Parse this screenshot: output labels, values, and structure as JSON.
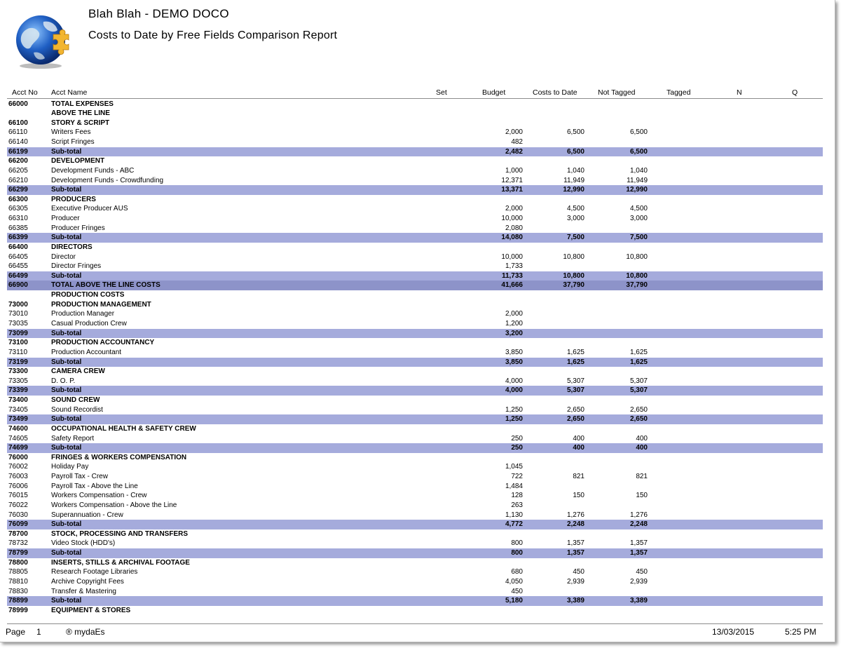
{
  "report": {
    "company": "Blah Blah - DEMO DOCO",
    "title": "Costs to Date by Free Fields Comparison Report"
  },
  "columns": {
    "acct_no": "Acct No",
    "acct_name": "Acct Name",
    "set": "Set",
    "budget": "Budget",
    "costs_to_date": "Costs to Date",
    "not_tagged": "Not Tagged",
    "tagged": "Tagged",
    "n": "N",
    "q": "Q"
  },
  "rows": [
    {
      "type": "head",
      "acct": "66000",
      "name": "TOTAL EXPENSES",
      "budget": "",
      "ctd": "",
      "nt": ""
    },
    {
      "type": "head",
      "acct": "",
      "name": "ABOVE THE LINE",
      "budget": "",
      "ctd": "",
      "nt": ""
    },
    {
      "type": "head",
      "acct": "66100",
      "name": "STORY & SCRIPT",
      "budget": "",
      "ctd": "",
      "nt": ""
    },
    {
      "type": "item",
      "acct": "66110",
      "name": "Writers Fees",
      "budget": "2,000",
      "ctd": "6,500",
      "nt": "6,500"
    },
    {
      "type": "item",
      "acct": "66140",
      "name": "Script Fringes",
      "budget": "482",
      "ctd": "",
      "nt": ""
    },
    {
      "type": "sub",
      "acct": "66199",
      "name": "Sub-total",
      "budget": "2,482",
      "ctd": "6,500",
      "nt": "6,500"
    },
    {
      "type": "head",
      "acct": "66200",
      "name": "DEVELOPMENT",
      "budget": "",
      "ctd": "",
      "nt": ""
    },
    {
      "type": "item",
      "acct": "66205",
      "name": "Development Funds - ABC",
      "budget": "1,000",
      "ctd": "1,040",
      "nt": "1,040"
    },
    {
      "type": "item",
      "acct": "66210",
      "name": "Development Funds - Crowdfunding",
      "budget": "12,371",
      "ctd": "11,949",
      "nt": "11,949"
    },
    {
      "type": "sub",
      "acct": "66299",
      "name": "Sub-total",
      "budget": "13,371",
      "ctd": "12,990",
      "nt": "12,990"
    },
    {
      "type": "head",
      "acct": "66300",
      "name": "PRODUCERS",
      "budget": "",
      "ctd": "",
      "nt": ""
    },
    {
      "type": "item",
      "acct": "66305",
      "name": "Executive Producer AUS",
      "budget": "2,000",
      "ctd": "4,500",
      "nt": "4,500"
    },
    {
      "type": "item",
      "acct": "66310",
      "name": "Producer",
      "budget": "10,000",
      "ctd": "3,000",
      "nt": "3,000"
    },
    {
      "type": "item",
      "acct": "66385",
      "name": "Producer Fringes",
      "budget": "2,080",
      "ctd": "",
      "nt": ""
    },
    {
      "type": "sub",
      "acct": "66399",
      "name": "Sub-total",
      "budget": "14,080",
      "ctd": "7,500",
      "nt": "7,500"
    },
    {
      "type": "head",
      "acct": "66400",
      "name": "DIRECTORS",
      "budget": "",
      "ctd": "",
      "nt": ""
    },
    {
      "type": "item",
      "acct": "66405",
      "name": "Director",
      "budget": "10,000",
      "ctd": "10,800",
      "nt": "10,800"
    },
    {
      "type": "item",
      "acct": "66455",
      "name": "Director Fringes",
      "budget": "1,733",
      "ctd": "",
      "nt": ""
    },
    {
      "type": "sub",
      "acct": "66499",
      "name": "Sub-total",
      "budget": "11,733",
      "ctd": "10,800",
      "nt": "10,800"
    },
    {
      "type": "tot",
      "acct": "66900",
      "name": "TOTAL ABOVE THE LINE COSTS",
      "budget": "41,666",
      "ctd": "37,790",
      "nt": "37,790"
    },
    {
      "type": "head",
      "acct": "",
      "name": "PRODUCTION COSTS",
      "budget": "",
      "ctd": "",
      "nt": ""
    },
    {
      "type": "head",
      "acct": "73000",
      "name": "PRODUCTION MANAGEMENT",
      "budget": "",
      "ctd": "",
      "nt": ""
    },
    {
      "type": "item",
      "acct": "73010",
      "name": "Production Manager",
      "budget": "2,000",
      "ctd": "",
      "nt": ""
    },
    {
      "type": "item",
      "acct": "73035",
      "name": "Casual Production Crew",
      "budget": "1,200",
      "ctd": "",
      "nt": ""
    },
    {
      "type": "sub",
      "acct": "73099",
      "name": "Sub-total",
      "budget": "3,200",
      "ctd": "",
      "nt": ""
    },
    {
      "type": "head",
      "acct": "73100",
      "name": "PRODUCTION ACCOUNTANCY",
      "budget": "",
      "ctd": "",
      "nt": ""
    },
    {
      "type": "item",
      "acct": "73110",
      "name": "Production Accountant",
      "budget": "3,850",
      "ctd": "1,625",
      "nt": "1,625"
    },
    {
      "type": "sub",
      "acct": "73199",
      "name": "Sub-total",
      "budget": "3,850",
      "ctd": "1,625",
      "nt": "1,625"
    },
    {
      "type": "head",
      "acct": "73300",
      "name": "CAMERA CREW",
      "budget": "",
      "ctd": "",
      "nt": ""
    },
    {
      "type": "item",
      "acct": "73305",
      "name": "D. O. P.",
      "budget": "4,000",
      "ctd": "5,307",
      "nt": "5,307"
    },
    {
      "type": "sub",
      "acct": "73399",
      "name": "Sub-total",
      "budget": "4,000",
      "ctd": "5,307",
      "nt": "5,307"
    },
    {
      "type": "head",
      "acct": "73400",
      "name": "SOUND CREW",
      "budget": "",
      "ctd": "",
      "nt": ""
    },
    {
      "type": "item",
      "acct": "73405",
      "name": "Sound Recordist",
      "budget": "1,250",
      "ctd": "2,650",
      "nt": "2,650"
    },
    {
      "type": "sub",
      "acct": "73499",
      "name": "Sub-total",
      "budget": "1,250",
      "ctd": "2,650",
      "nt": "2,650"
    },
    {
      "type": "head",
      "acct": "74600",
      "name": "OCCUPATIONAL HEALTH & SAFETY CREW",
      "budget": "",
      "ctd": "",
      "nt": ""
    },
    {
      "type": "item",
      "acct": "74605",
      "name": "Safety Report",
      "budget": "250",
      "ctd": "400",
      "nt": "400"
    },
    {
      "type": "sub",
      "acct": "74699",
      "name": "Sub-total",
      "budget": "250",
      "ctd": "400",
      "nt": "400"
    },
    {
      "type": "head",
      "acct": "76000",
      "name": "FRINGES & WORKERS COMPENSATION",
      "budget": "",
      "ctd": "",
      "nt": ""
    },
    {
      "type": "item",
      "acct": "76002",
      "name": "Holiday Pay",
      "budget": "1,045",
      "ctd": "",
      "nt": ""
    },
    {
      "type": "item",
      "acct": "76003",
      "name": "Payroll Tax - Crew",
      "budget": "722",
      "ctd": "821",
      "nt": "821"
    },
    {
      "type": "item",
      "acct": "76006",
      "name": "Payroll Tax - Above the Line",
      "budget": "1,484",
      "ctd": "",
      "nt": ""
    },
    {
      "type": "item",
      "acct": "76015",
      "name": "Workers Compensation - Crew",
      "budget": "128",
      "ctd": "150",
      "nt": "150"
    },
    {
      "type": "item",
      "acct": "76022",
      "name": "Workers Compensation - Above the Line",
      "budget": "263",
      "ctd": "",
      "nt": ""
    },
    {
      "type": "item",
      "acct": "76030",
      "name": "Superannuation - Crew",
      "budget": "1,130",
      "ctd": "1,276",
      "nt": "1,276"
    },
    {
      "type": "sub",
      "acct": "76099",
      "name": "Sub-total",
      "budget": "4,772",
      "ctd": "2,248",
      "nt": "2,248"
    },
    {
      "type": "head",
      "acct": "78700",
      "name": "STOCK, PROCESSING AND TRANSFERS",
      "budget": "",
      "ctd": "",
      "nt": ""
    },
    {
      "type": "item",
      "acct": "78732",
      "name": "Video Stock (HDD's)",
      "budget": "800",
      "ctd": "1,357",
      "nt": "1,357"
    },
    {
      "type": "sub",
      "acct": "78799",
      "name": "Sub-total",
      "budget": "800",
      "ctd": "1,357",
      "nt": "1,357"
    },
    {
      "type": "head",
      "acct": "78800",
      "name": "INSERTS, STILLS & ARCHIVAL FOOTAGE",
      "budget": "",
      "ctd": "",
      "nt": ""
    },
    {
      "type": "item",
      "acct": "78805",
      "name": "Research Footage Libraries",
      "budget": "680",
      "ctd": "450",
      "nt": "450"
    },
    {
      "type": "item",
      "acct": "78810",
      "name": "Archive Copyright Fees",
      "budget": "4,050",
      "ctd": "2,939",
      "nt": "2,939"
    },
    {
      "type": "item",
      "acct": "78830",
      "name": "Transfer & Mastering",
      "budget": "450",
      "ctd": "",
      "nt": ""
    },
    {
      "type": "sub",
      "acct": "78899",
      "name": "Sub-total",
      "budget": "5,180",
      "ctd": "3,389",
      "nt": "3,389"
    },
    {
      "type": "head",
      "acct": "78999",
      "name": "EQUIPMENT & STORES",
      "budget": "",
      "ctd": "",
      "nt": ""
    }
  ],
  "footer": {
    "page_label": "Page",
    "page_number": "1",
    "brand": "® mydaEs",
    "date": "13/03/2015",
    "time": "5:25 PM"
  },
  "colors": {
    "subtotal_band": "#a5abdc",
    "total_band": "#8d93c9"
  }
}
